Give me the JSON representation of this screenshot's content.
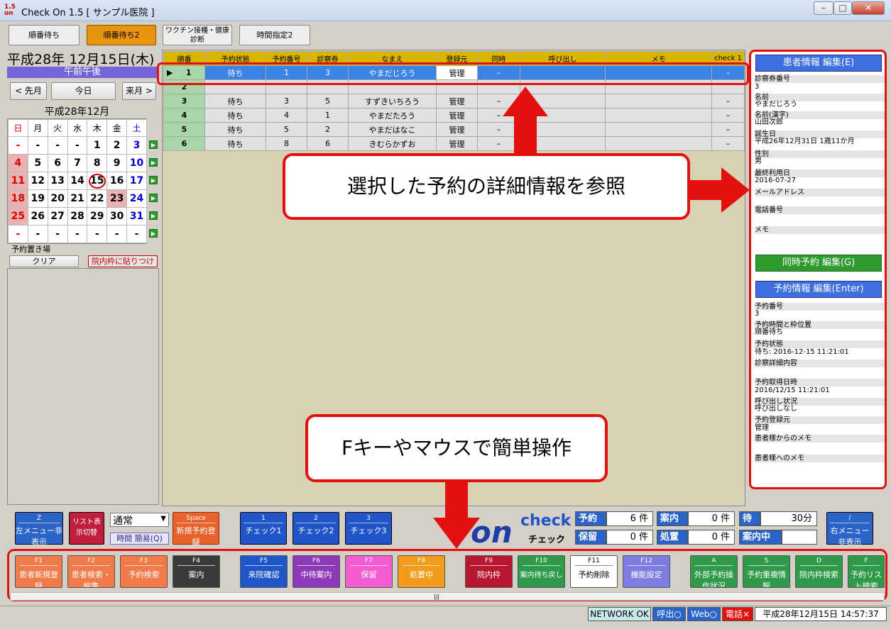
{
  "window": {
    "title": "Check On 1.5 [ サンプル医院 ]",
    "icon_text": "1.5 on",
    "min": "–",
    "max": "□",
    "close": "✕"
  },
  "tabs": [
    "順番待ち",
    "順番待ち2",
    "ワクチン接種・健康診断",
    "時間指定2"
  ],
  "left": {
    "date": "平成28年 12月15日(木)",
    "period": "午前午後",
    "prev": "< 先月",
    "today": "今日",
    "next": "来月 >",
    "month": "平成28年12月",
    "weekdays": [
      "日",
      "月",
      "火",
      "水",
      "木",
      "金",
      "土"
    ],
    "weeks": [
      [
        "-",
        "-",
        "-",
        "-",
        "1",
        "2",
        "3"
      ],
      [
        "4",
        "5",
        "6",
        "7",
        "8",
        "9",
        "10"
      ],
      [
        "11",
        "12",
        "13",
        "14",
        "15",
        "16",
        "17"
      ],
      [
        "18",
        "19",
        "20",
        "21",
        "22",
        "23",
        "24"
      ],
      [
        "25",
        "26",
        "27",
        "28",
        "29",
        "30",
        "31"
      ],
      [
        "-",
        "-",
        "-",
        "-",
        "-",
        "-",
        "-"
      ]
    ],
    "stash_label": "予約置き場",
    "clear": "クリア",
    "paste": "院内枠に貼りつけ"
  },
  "table": {
    "headers": [
      "順番",
      "予約状態",
      "予約番号",
      "診察券",
      "なまえ",
      "登録元",
      "同時",
      "呼び出し",
      "メモ",
      "check 1"
    ],
    "rows": [
      [
        "1",
        "待ち",
        "1",
        "3",
        "やまだじろう",
        "管理",
        "–",
        "",
        "",
        "–"
      ],
      [
        "2",
        "",
        "",
        "",
        "",
        "",
        "",
        "",
        "",
        ""
      ],
      [
        "3",
        "待ち",
        "3",
        "5",
        "すずきいちろう",
        "管理",
        "–",
        "",
        "",
        "–"
      ],
      [
        "4",
        "待ち",
        "4",
        "1",
        "やまだたろう",
        "管理",
        "–",
        "",
        "",
        "–"
      ],
      [
        "5",
        "待ち",
        "5",
        "2",
        "やまだはなこ",
        "管理",
        "–",
        "",
        "",
        "–"
      ],
      [
        "6",
        "待ち",
        "8",
        "6",
        "きむらかずお",
        "管理",
        "–",
        "",
        "",
        "–"
      ]
    ]
  },
  "callouts": {
    "detail": "選択した予約の詳細情報を参照",
    "fkeys": "Fキーやマウスで簡単操作"
  },
  "patient": {
    "edit": "患者情報 編集(E)",
    "fields": [
      [
        "診察券番号",
        "3"
      ],
      [
        "名前",
        "やまだじろう"
      ],
      [
        "名前(漢字)",
        "山田次郎"
      ],
      [
        "誕生日",
        "平成26年12月31日 1歳11か月"
      ],
      [
        "性別",
        "男"
      ],
      [
        "最終利用日",
        "2016-07-27"
      ],
      [
        "メールアドレス",
        ""
      ],
      [
        "電話番号",
        ""
      ],
      [
        "メモ",
        ""
      ]
    ],
    "same": "同時予約 編集(G)",
    "resv_edit": "予約情報 編集(Enter)",
    "resv": [
      [
        "予約番号",
        "3"
      ],
      [
        "予約時間と枠位置",
        "順番待ち"
      ],
      [
        "予約状態",
        "待ち: 2016-12-15 11:21:01"
      ],
      [
        "診察詳細内容",
        ""
      ],
      [
        "予約取得日時",
        "2016/12/15 11:21:01"
      ],
      [
        "呼び出し状況",
        "呼び出しなし"
      ],
      [
        "予約登録元",
        "管理"
      ],
      [
        "患者様からのメモ",
        ""
      ],
      [
        "患者様へのメモ",
        ""
      ]
    ]
  },
  "bottom": {
    "menu_key": "Z",
    "menu": "左メニュー非表示",
    "list": "リスト表示切替",
    "mode": "通常",
    "time": "時間 簡易(Q)",
    "space_key": "Space",
    "new": "新規予約登録",
    "checks": [
      [
        "1",
        "チェック1"
      ],
      [
        "2",
        "チェック2"
      ],
      [
        "3",
        "チェック3"
      ]
    ],
    "logo": "check",
    "logo_sub": "チェック",
    "stats": [
      [
        "予約",
        "6 件"
      ],
      [
        "案内",
        "0 件"
      ],
      [
        "待",
        "30分"
      ],
      [
        "保留",
        "0 件"
      ],
      [
        "処置",
        "0 件"
      ],
      [
        "案内中",
        ""
      ]
    ],
    "right_key": "/",
    "right": "右メニュー非表示"
  },
  "fkeys": [
    [
      "F1",
      "患者新規登録"
    ],
    [
      "F2",
      "患者検索・編集"
    ],
    [
      "F3",
      "予約検索"
    ],
    [
      "F4",
      "案内"
    ],
    [
      "F5",
      "来院確認"
    ],
    [
      "F6",
      "中待案内"
    ],
    [
      "F7",
      "保留"
    ],
    [
      "F8",
      "処置中"
    ],
    [
      "F9",
      "院内枠"
    ],
    [
      "F10",
      "案内待ち戻し"
    ],
    [
      "F11",
      "予約削除"
    ],
    [
      "F12",
      "機能設定"
    ],
    [
      "A",
      "外部予約操作状況"
    ],
    [
      "S",
      "予約重複情報"
    ],
    [
      "D",
      "院内枠検索"
    ],
    [
      "F",
      "予約リスト検索"
    ]
  ],
  "status": {
    "net": "NETWORK OK",
    "call": "呼出○",
    "web": "Web○",
    "tel": "電話×",
    "time": "平成28年12月15日 14:57:37"
  },
  "colors": {
    "accent": "#e31010",
    "select": "#3c83e8"
  }
}
